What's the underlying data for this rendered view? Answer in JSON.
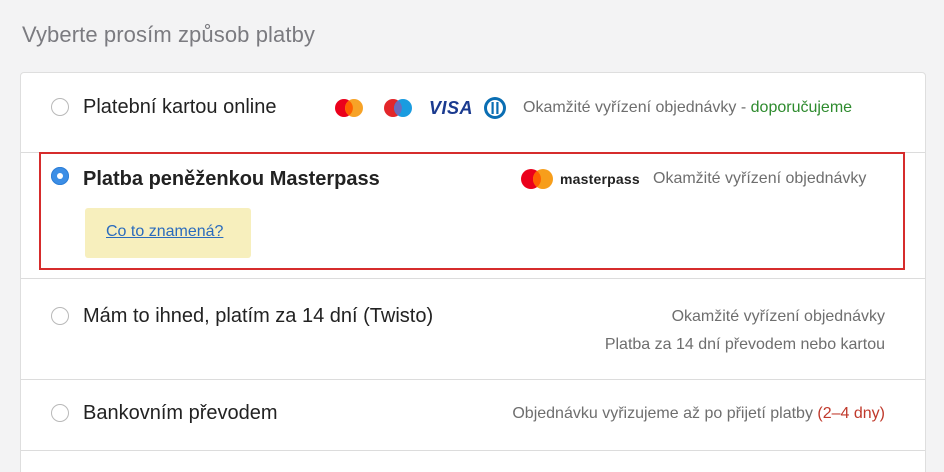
{
  "page": {
    "title": "Vyberte prosím způsob platby"
  },
  "options": [
    {
      "label": "Platební kartou online",
      "selected": false,
      "icons": [
        "mastercard-icon",
        "maestro-icon",
        "visa-icon",
        "diners-club-icon"
      ],
      "visa_text": "VISA",
      "note": "Okamžité vyřízení objednávky - ",
      "note_highlight": "doporučujeme"
    },
    {
      "label": "Platba peněženkou Masterpass",
      "selected": true,
      "icons": [
        "masterpass-icon"
      ],
      "brand_text": "masterpass",
      "note": "Okamžité vyřízení objednávky",
      "help_link": "Co to znamená?"
    },
    {
      "label": "Mám to ihned, platím za 14 dní (Twisto)",
      "selected": false,
      "note": "Okamžité vyřízení objednávky",
      "note2": "Platba za 14 dní převodem nebo kartou"
    },
    {
      "label": "Bankovním převodem",
      "selected": false,
      "note": "Objednávku vyřizujeme až po přijetí platby ",
      "note_highlight": "(2–4 dny)"
    }
  ],
  "colors": {
    "accent": "#3b8ee6",
    "highlight_border": "#d62c2c",
    "recommended": "#2e8b2e",
    "warning": "#c0392b",
    "help_bg": "#f7efbd",
    "link": "#2a6bbd"
  }
}
